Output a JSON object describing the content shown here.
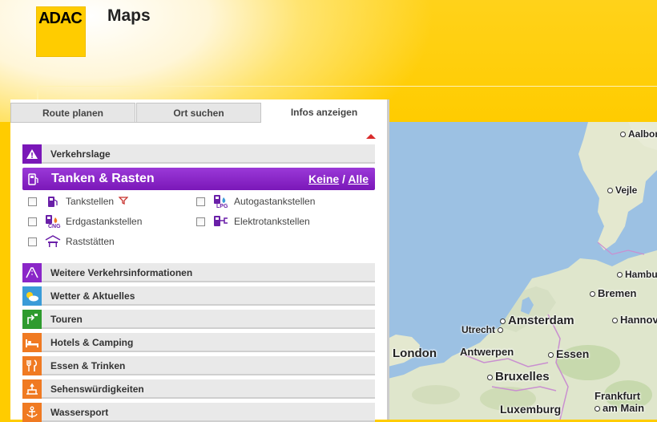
{
  "header": {
    "logo_text": "ADAC",
    "app_title": "Maps"
  },
  "tabs": [
    {
      "label": "Route planen",
      "active": false
    },
    {
      "label": "Ort suchen",
      "active": false
    },
    {
      "label": "Infos anzeigen",
      "active": true
    }
  ],
  "sections": {
    "verkehrslage": {
      "label": "Verkehrslage",
      "icon": "warning-icon",
      "color": "#7a17b8"
    },
    "tanken": {
      "label": "Tanken & Rasten",
      "icon": "fuel-pump-icon",
      "color": "#8a26c8",
      "keine": "Keine",
      "separator": "/",
      "alle": "Alle",
      "options": [
        {
          "label": "Tankstellen",
          "icon": "fuel-pump-icon",
          "checked": false,
          "has_filter": true
        },
        {
          "label": "Autogastankstellen",
          "icon": "lpg-pump-icon",
          "icon_sub": "LPG",
          "checked": false
        },
        {
          "label": "Erdgastankstellen",
          "icon": "cng-pump-icon",
          "icon_sub": "CNG",
          "checked": false
        },
        {
          "label": "Elektrotankstellen",
          "icon": "electric-pump-icon",
          "checked": false
        },
        {
          "label": "Raststätten",
          "icon": "rest-stop-icon",
          "checked": false
        }
      ]
    },
    "more": [
      {
        "label": "Weitere Verkehrsinformationen",
        "icon": "road-info-icon",
        "color": "#8a26c8"
      },
      {
        "label": "Wetter & Aktuelles",
        "icon": "weather-icon",
        "color": "#3a9bd8"
      },
      {
        "label": "Touren",
        "icon": "route-sign-icon",
        "color": "#2e9b2e"
      },
      {
        "label": "Hotels & Camping",
        "icon": "bed-icon",
        "color": "#f07a22"
      },
      {
        "label": "Essen & Trinken",
        "icon": "cutlery-icon",
        "color": "#f07a22"
      },
      {
        "label": "Sehenswürdigkeiten",
        "icon": "landmark-icon",
        "color": "#f07a22"
      },
      {
        "label": "Wassersport",
        "icon": "anchor-icon",
        "color": "#f07a22"
      }
    ]
  },
  "map": {
    "cities": [
      "Aalborg",
      "Vejle",
      "Hamburg",
      "Bremen",
      "Amsterdam",
      "Utrecht",
      "Hannover",
      "London",
      "Antwerpen",
      "Essen",
      "Bruxelles",
      "Frankfurt",
      "am Main",
      "Luxemburg"
    ]
  }
}
